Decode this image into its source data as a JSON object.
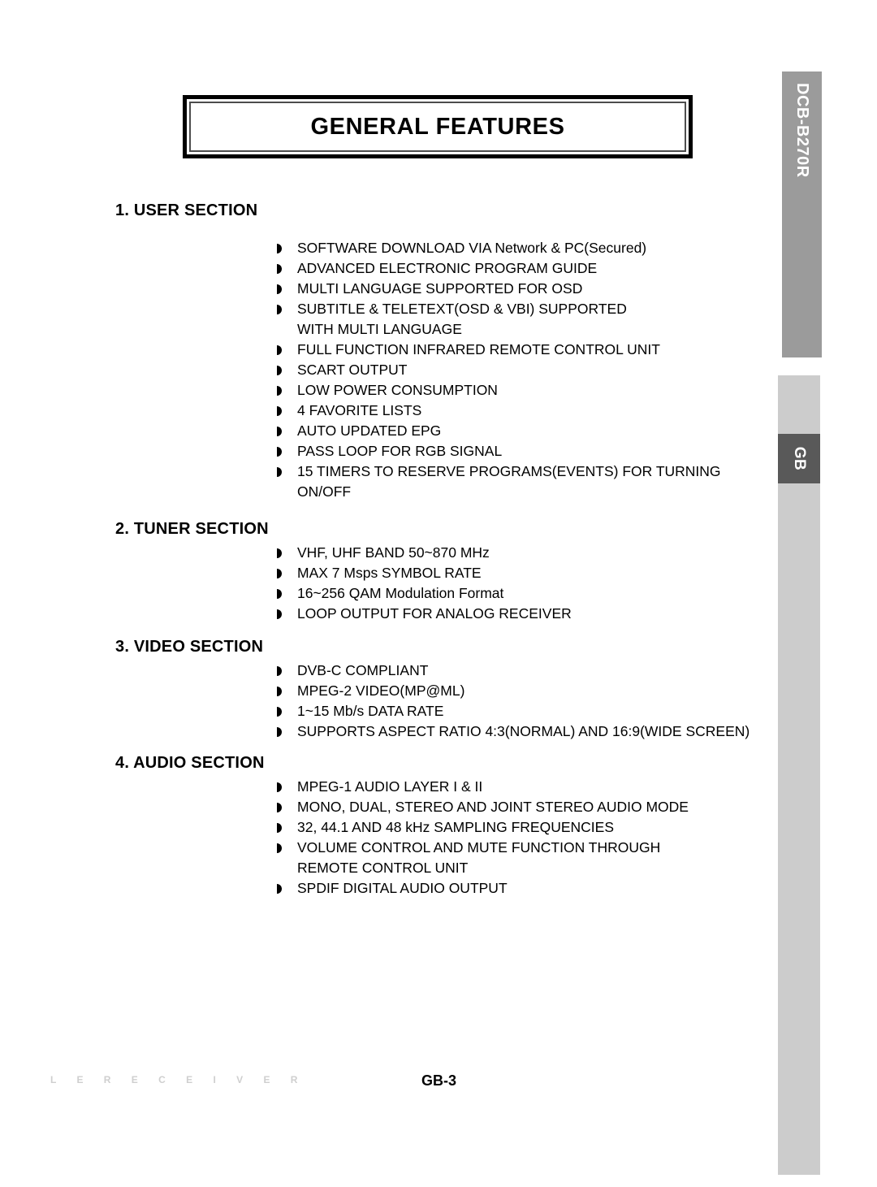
{
  "document": {
    "title": "GENERAL FEATURES",
    "model_tab": "DCB-B270R",
    "language_tab": "GB",
    "footer": {
      "watermark": "L E  R E C E I V E R",
      "page_number": "GB-3"
    }
  },
  "sections": [
    {
      "heading": "1. USER SECTION",
      "items": [
        {
          "text": "SOFTWARE DOWNLOAD VIA Network & PC(Secured)"
        },
        {
          "text": "ADVANCED ELECTRONIC PROGRAM GUIDE"
        },
        {
          "text": "MULTI LANGUAGE SUPPORTED FOR OSD"
        },
        {
          "text": "SUBTITLE & TELETEXT(OSD & VBI) SUPPORTED",
          "continuation": "WITH MULTI LANGUAGE"
        },
        {
          "text": "FULL FUNCTION INFRARED REMOTE CONTROL UNIT"
        },
        {
          "text": "SCART OUTPUT"
        },
        {
          "text": "LOW POWER CONSUMPTION"
        },
        {
          "text": "4 FAVORITE LISTS"
        },
        {
          "text": "AUTO UPDATED EPG"
        },
        {
          "text": "PASS LOOP FOR RGB SIGNAL"
        },
        {
          "text": "15 TIMERS TO RESERVE PROGRAMS(EVENTS) FOR TURNING",
          "continuation": "ON/OFF"
        }
      ]
    },
    {
      "heading": "2. TUNER SECTION",
      "items": [
        {
          "text": "VHF, UHF BAND 50~870 MHz"
        },
        {
          "text": "MAX 7 Msps SYMBOL RATE"
        },
        {
          "text": "16~256 QAM Modulation Format"
        },
        {
          "text": "LOOP OUTPUT FOR ANALOG RECEIVER"
        }
      ]
    },
    {
      "heading": "3. VIDEO SECTION",
      "items": [
        {
          "text": "DVB-C COMPLIANT"
        },
        {
          "text": "MPEG-2 VIDEO(MP@ML)"
        },
        {
          "text": "1~15 Mb/s DATA RATE"
        },
        {
          "text": "SUPPORTS ASPECT RATIO 4:3(NORMAL) AND 16:9(WIDE SCREEN)"
        }
      ]
    },
    {
      "heading": "4. AUDIO SECTION",
      "items": [
        {
          "text": "MPEG-1 AUDIO LAYER I & II"
        },
        {
          "text": "MONO, DUAL, STEREO AND JOINT STEREO AUDIO MODE"
        },
        {
          "text": "32, 44.1 AND 48 kHz SAMPLING FREQUENCIES"
        },
        {
          "text": "VOLUME CONTROL AND MUTE FUNCTION THROUGH",
          "continuation": "REMOTE CONTROL UNIT"
        },
        {
          "text": "SPDIF DIGITAL AUDIO OUTPUT"
        }
      ]
    }
  ],
  "colors": {
    "tab_dark": "#9b9b9b",
    "tab_light": "#cccccc",
    "tab_gb": "#595959",
    "text": "#000000",
    "watermark": "#cfcfcf"
  },
  "layout": {
    "section_tops": [
      248,
      640,
      785,
      928
    ]
  }
}
